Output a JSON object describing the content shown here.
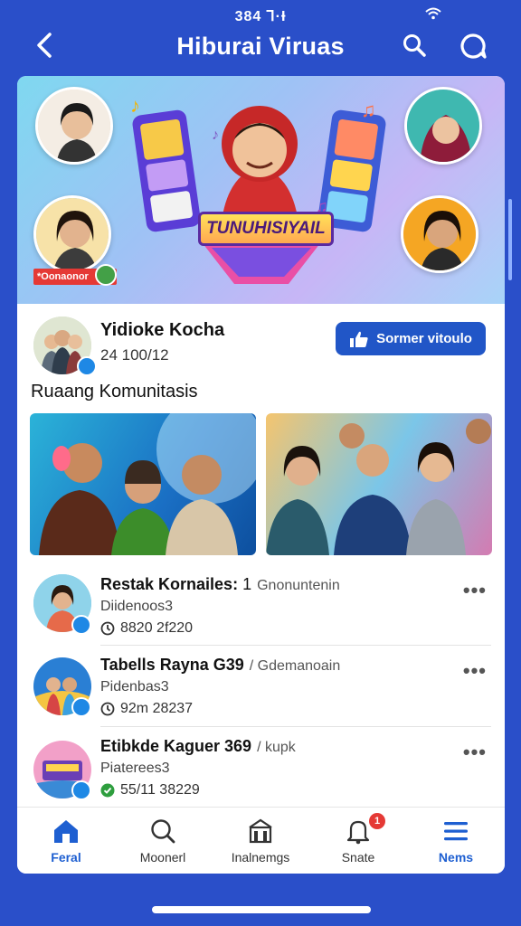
{
  "status_bar": {
    "time": "384 Ꞁ·Ɨ"
  },
  "app_bar": {
    "title": "Hiburai Viruas"
  },
  "banner": {
    "title_text": "TUNUHISIYAIL",
    "badge_text": "*Oonaonor"
  },
  "profile": {
    "name": "Yidioke Kocha",
    "sub": "24 100/12",
    "follow_label": "Sormer vitoulo"
  },
  "section": {
    "title": "Ruaang Komunitasis"
  },
  "list": [
    {
      "title": "Restak Kornailes:",
      "number": "1",
      "meta": "Gnonuntenin",
      "sub": "Diidenoos3",
      "time": "8820 2f220",
      "time_icon": "clock-icon"
    },
    {
      "title": "Tabells Rayna G39",
      "number": "",
      "meta": "/ Gdemanoain",
      "sub": "Pidenbas3",
      "time": "92m 28237",
      "time_icon": "clock-icon"
    },
    {
      "title": "Etibkde Kaguer 369",
      "number": "",
      "meta": "/ kupk",
      "sub": "Piaterees3",
      "time": "55/11 38229",
      "time_icon": "check-icon"
    }
  ],
  "nav": [
    {
      "label": "Feral",
      "icon": "home-icon",
      "active": true
    },
    {
      "label": "Moonerl",
      "icon": "search-icon",
      "active": false
    },
    {
      "label": "Inalnemgs",
      "icon": "building-icon",
      "active": false
    },
    {
      "label": "Snate",
      "icon": "bell-icon",
      "active": false,
      "badge": "1"
    },
    {
      "label": "Nems",
      "icon": "menu-icon",
      "active": false
    }
  ],
  "colors": {
    "primary": "#2156c7",
    "background": "#2a4fc9",
    "accent_red": "#e53935",
    "accent_green": "#43a047"
  }
}
